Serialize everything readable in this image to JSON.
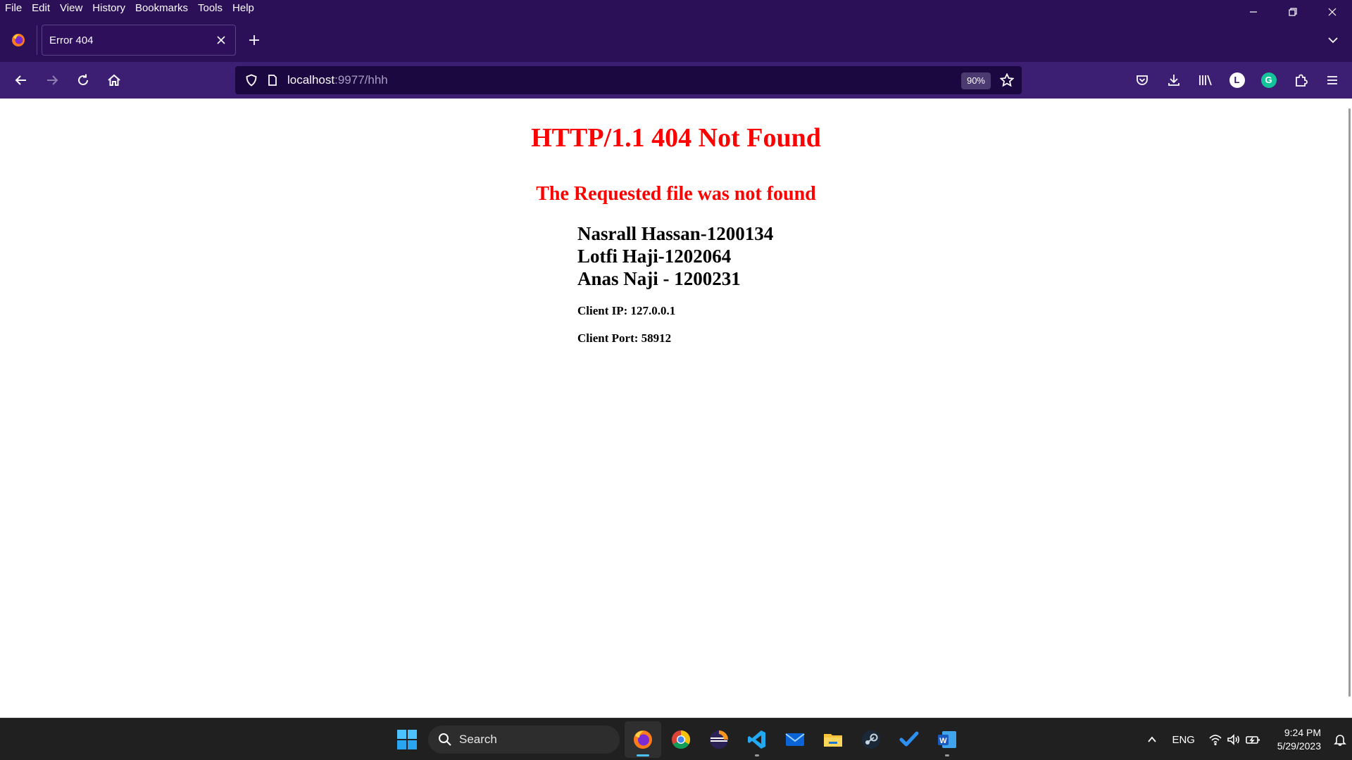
{
  "browser": {
    "menu": [
      "File",
      "Edit",
      "View",
      "History",
      "Bookmarks",
      "Tools",
      "Help"
    ],
    "tab": {
      "title": "Error 404"
    },
    "url": {
      "host": "localhost",
      "rest": ":9977/hhh"
    },
    "zoom": "90%",
    "icons": {
      "logo": "firefox-logo-icon",
      "back": "back-arrow-icon",
      "forward": "forward-arrow-icon",
      "reload": "reload-icon",
      "home": "home-icon",
      "shield": "tracking-protection-shield-icon",
      "page": "page-icon",
      "star": "bookmark-star-icon",
      "pocket": "pocket-icon",
      "downloads": "download-icon",
      "library": "library-icon",
      "account": "account-avatar-L",
      "grammarly": "grammarly-icon",
      "extensions": "extensions-icon",
      "menu": "hamburger-menu-icon"
    },
    "toolbar_avatar_letter": "L",
    "grammarly_letter": "G"
  },
  "page": {
    "heading": "HTTP/1.1 404 Not Found",
    "subheading": "The Requested file was not found",
    "names": [
      "Nasrall Hassan-1200134",
      "Lotfi Haji-1202064",
      "Anas Naji - 1200231"
    ],
    "client_ip": "Client IP: 127.0.0.1",
    "client_port": "Client Port: 58912"
  },
  "taskbar": {
    "search_label": "Search",
    "apps": [
      "Firefox",
      "Chrome",
      "Eclipse",
      "Visual Studio Code",
      "Mail",
      "File Explorer",
      "Steam",
      "To Do",
      "Word"
    ],
    "language": "ENG",
    "time": "9:24 PM",
    "date": "5/29/2023"
  },
  "colors": {
    "chrome_dark": "#2b1057",
    "nav_bar": "#3c1f73",
    "urlbar_bg": "#1c0840",
    "heading_red": "#ff0000",
    "taskbar_bg": "#202020"
  }
}
